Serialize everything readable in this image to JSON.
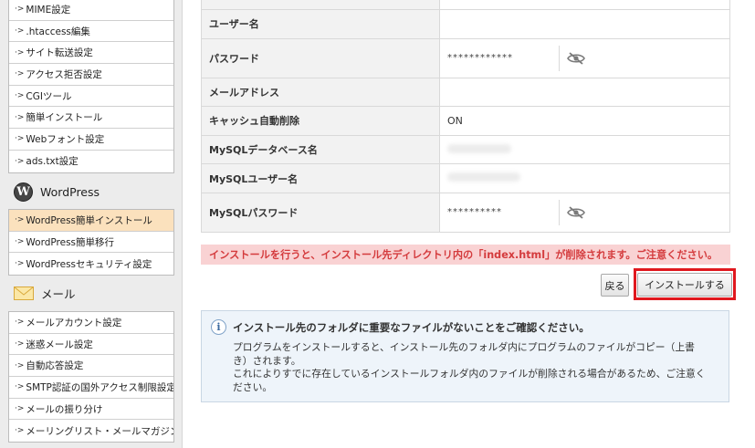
{
  "sidebar": {
    "group1": [
      {
        "label": "MIME設定"
      },
      {
        "label": ".htaccess編集"
      },
      {
        "label": "サイト転送設定"
      },
      {
        "label": "アクセス拒否設定"
      },
      {
        "label": "CGIツール"
      },
      {
        "label": "簡単インストール"
      },
      {
        "label": "Webフォント設定"
      },
      {
        "label": "ads.txt設定"
      }
    ],
    "wordpress_heading": "WordPress",
    "wordpress_items": [
      {
        "label": "WordPress簡単インストール",
        "active": true
      },
      {
        "label": "WordPress簡単移行"
      },
      {
        "label": "WordPressセキュリティ設定"
      }
    ],
    "mail_heading": "メール",
    "mail_items": [
      {
        "label": "メールアカウント設定"
      },
      {
        "label": "迷惑メール設定"
      },
      {
        "label": "自動応答設定"
      },
      {
        "label": "SMTP認証の国外アクセス制限設定"
      },
      {
        "label": "メールの振り分け"
      },
      {
        "label": "メーリングリスト・メールマガジン"
      }
    ]
  },
  "form": {
    "username_label": "ユーザー名",
    "password_label": "パスワード",
    "password_value": "************",
    "email_label": "メールアドレス",
    "cache_label": "キャッシュ自動削除",
    "cache_value": "ON",
    "db_name_label": "MySQLデータベース名",
    "db_user_label": "MySQLユーザー名",
    "db_password_label": "MySQLパスワード",
    "db_password_value": "**********"
  },
  "warning_text": "インストールを行うと、インストール先ディレクトリ内の「index.html」が削除されます。ご注意ください。",
  "buttons": {
    "back": "戻る",
    "install": "インストールする"
  },
  "info": {
    "title": "インストール先のフォルダに重要なファイルがないことをご確認ください。",
    "line1": "プログラムをインストールすると、インストール先のフォルダ内にプログラムのファイルがコピー（上書き）されます。",
    "line2": "これによりすでに存在しているインストールフォルダ内のファイルが削除される場合があるため、ご注意ください。"
  },
  "colors": {
    "warning_bg": "#f9d2d3",
    "warning_text": "#d43b3d",
    "highlight_outline": "#e0181e",
    "active_sidebar": "#fbe1bd",
    "info_bg": "#eef4fa"
  }
}
